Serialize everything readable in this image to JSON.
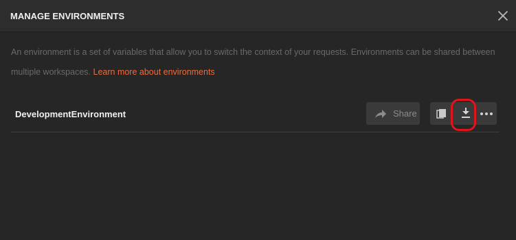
{
  "modal": {
    "title": "MANAGE ENVIRONMENTS",
    "close_icon": "close-icon"
  },
  "description": {
    "text": "An environment is a set of variables that allow you to switch the context of your requests. Environments can be shared between multiple workspaces. ",
    "link_text": "Learn more about environments"
  },
  "environments": [
    {
      "name": "DevelopmentEnvironment",
      "share_label": "Share",
      "actions": [
        "duplicate-icon",
        "download-icon",
        "more-icon"
      ]
    }
  ],
  "colors": {
    "background": "#262626",
    "header": "#2d2d2d",
    "link": "#f26b3a",
    "highlight": "#e0141b",
    "button": "#3a3a3a"
  }
}
